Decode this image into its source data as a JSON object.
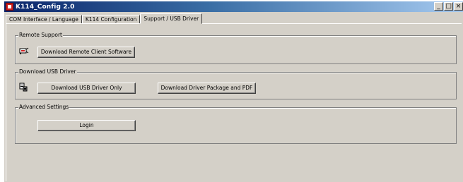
{
  "window": {
    "title": "K114_Config 2.0",
    "controls": {
      "minimize": "_",
      "maximize": "□",
      "close": "×"
    }
  },
  "tabs": [
    {
      "label": "COM Interface / Language",
      "active": false
    },
    {
      "label": "K114 Configuration",
      "active": false
    },
    {
      "label": "Support / USB Driver",
      "active": true
    }
  ],
  "groups": {
    "remote_support": {
      "label": "Remote Support",
      "icon": "remote-connection-icon",
      "button": "Download Remote Client Software"
    },
    "usb_driver": {
      "label": "Download USB Driver",
      "icon": "usb-driver-icon",
      "button_driver_only": "Download USB Driver Only",
      "button_package": "Download Driver Package and PDF"
    },
    "advanced": {
      "label": "Advanced Settings",
      "button_login": "Login"
    }
  }
}
